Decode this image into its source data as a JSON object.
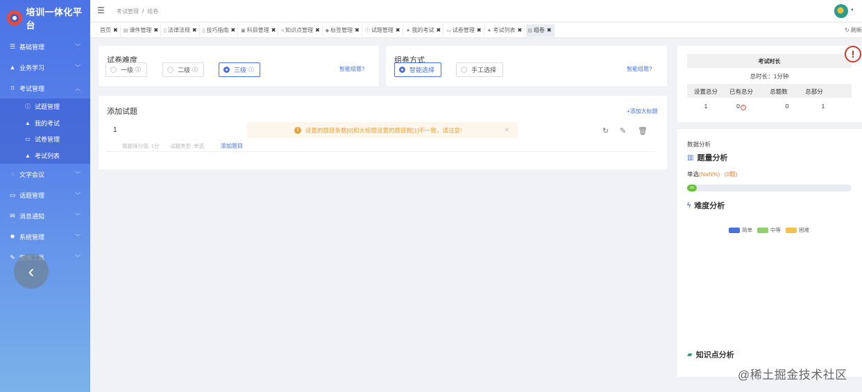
{
  "app": {
    "title": "培训一体化平台"
  },
  "sidebar": {
    "items": [
      {
        "label": "基础管理",
        "icon": "list-icon",
        "glyph": "☰"
      },
      {
        "label": "业务学习",
        "icon": "graduation-cap-icon",
        "glyph": "🎓"
      },
      {
        "label": "考试管理",
        "icon": "bookmark-icon",
        "glyph": "⌑"
      }
    ],
    "submenu": [
      {
        "label": "试题管理",
        "icon": "question-icon",
        "glyph": "?"
      },
      {
        "label": "我的考试",
        "icon": "graduation-cap-icon",
        "glyph": "▲"
      },
      {
        "label": "试卷管理",
        "icon": "card-icon",
        "glyph": "▭"
      },
      {
        "label": "考试列表",
        "icon": "graduation-cap-icon",
        "glyph": "▲"
      }
    ],
    "items_after": [
      {
        "label": "文字会议",
        "icon": "chat-icon",
        "glyph": "◌"
      },
      {
        "label": "话题管理",
        "icon": "card-icon",
        "glyph": "▭"
      },
      {
        "label": "消息通知",
        "icon": "envelope-icon",
        "glyph": "✉"
      },
      {
        "label": "系统管理",
        "icon": "gear-icon",
        "glyph": "✹"
      },
      {
        "label": "常用工具",
        "icon": "wrench-icon",
        "glyph": "✎"
      }
    ]
  },
  "header": {
    "breadcrumb": [
      "考试管理",
      "组卷"
    ]
  },
  "tabs": [
    {
      "label": "首页"
    },
    {
      "label": "课件管理"
    },
    {
      "label": "法律法规"
    },
    {
      "label": "技巧指南"
    },
    {
      "label": "科目管理"
    },
    {
      "label": "知识点管理"
    },
    {
      "label": "标签管理"
    },
    {
      "label": "试题管理"
    },
    {
      "label": "我的考试"
    },
    {
      "label": "试卷管理"
    },
    {
      "label": "考试列表"
    },
    {
      "label": "组卷",
      "active": true
    }
  ],
  "refresh_label": "刷新",
  "difficulty": {
    "title": "试卷难度",
    "options": [
      "一级",
      "二级",
      "三级"
    ],
    "selected": "三级",
    "help_link": "智能组题?"
  },
  "method": {
    "title": "组卷方式",
    "options": [
      "智能选择",
      "手工选择"
    ],
    "selected": "智能选择",
    "help_link": "智能组题?"
  },
  "add_questions": {
    "title": "添加试题",
    "add_section_link": "+添加大标题",
    "row_index": "1",
    "per_score": "每题得分值: 1分",
    "question_type": "试题类型: 单选",
    "add_question_link": "添加题目",
    "alert": "设置的题目条数[0]和大标题设置的题目数[1]不一致，请注意!"
  },
  "exam": {
    "duration_title": "考试时长",
    "total_time": "总时长：1分钟",
    "headers": [
      "设置总分",
      "已有总分",
      "总题数",
      "总部分"
    ],
    "values": [
      "1",
      "0",
      "0",
      "1"
    ]
  },
  "analysis": {
    "label": "数据分析",
    "count_title": "题量分析",
    "single_label": "单选",
    "single_pct": "(NaN%)",
    "single_count": "(0题)",
    "progress_text": "xx",
    "progress_fraction": 0.0,
    "difficulty_title": "难度分析",
    "legend": [
      {
        "label": "简单",
        "color": "#4a6fd6"
      },
      {
        "label": "中等",
        "color": "#8fcf6e"
      },
      {
        "label": "困难",
        "color": "#f2c14e"
      }
    ],
    "knowledge_title": "知识点分析"
  },
  "watermark": "@稀土掘金技术社区"
}
